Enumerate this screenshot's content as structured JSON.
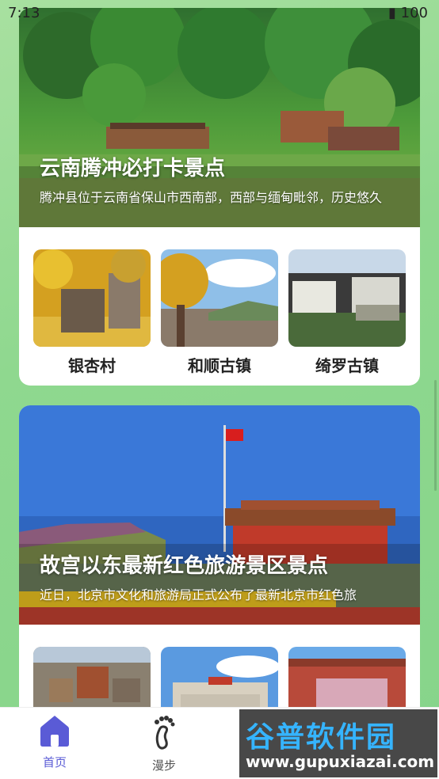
{
  "status_bar": {
    "time": "7:13",
    "icons": "▮ 100"
  },
  "cards": [
    {
      "title": "云南腾冲必打卡景点",
      "description": "腾冲县位于云南省保山市西南部，西部与缅甸毗邻，历史悠久",
      "spots": [
        {
          "name": "银杏村"
        },
        {
          "name": "和顺古镇"
        },
        {
          "name": "绮罗古镇"
        }
      ]
    },
    {
      "title": "故宫以东最新红色旅游景区景点",
      "description": "近日，北京市文化和旅游局正式公布了最新北京市红色旅",
      "spots": [
        {
          "name": ""
        },
        {
          "name": ""
        },
        {
          "name": ""
        }
      ]
    }
  ],
  "nav": {
    "home": "首页",
    "walk": "漫步"
  },
  "watermark": {
    "brand": "谷普软件园",
    "url": "www.gupuxiazai.com"
  }
}
